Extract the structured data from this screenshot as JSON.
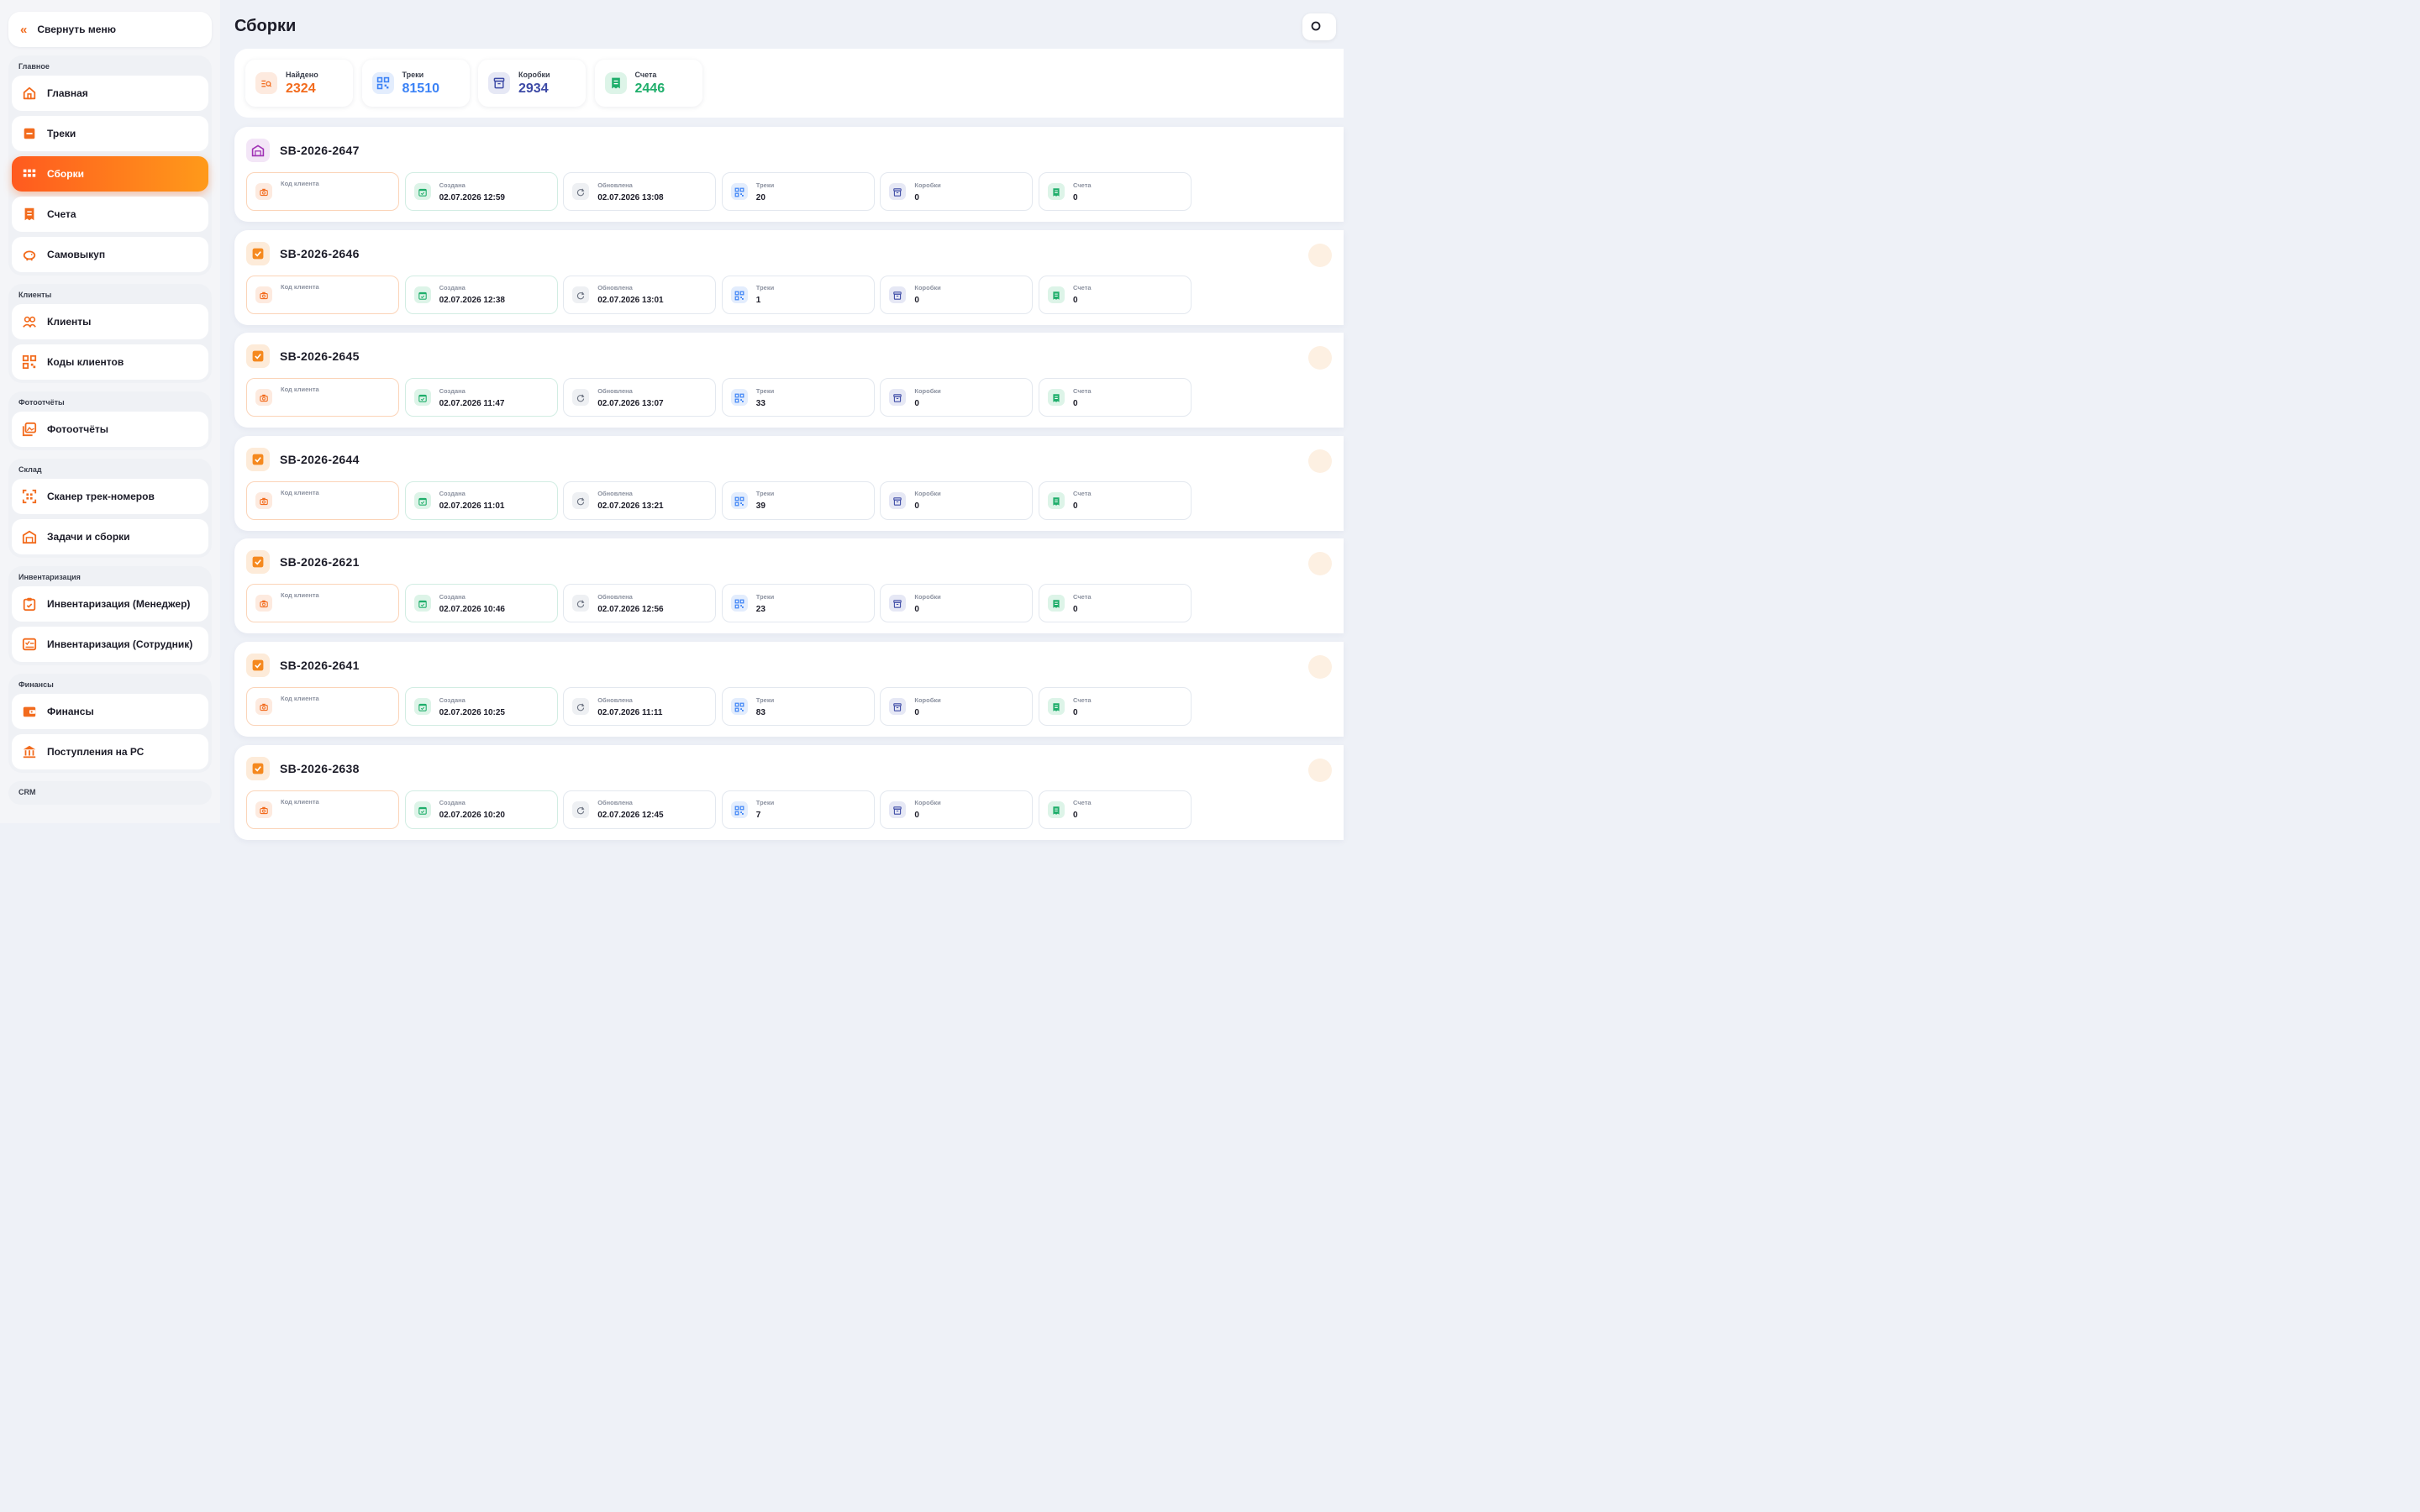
{
  "sidebar": {
    "collapse_label": "Свернуть меню",
    "groups": [
      {
        "title": "Главное",
        "items": [
          {
            "label": "Главная",
            "icon": "home-icon"
          },
          {
            "label": "Треки",
            "icon": "box-icon"
          },
          {
            "label": "Сборки",
            "icon": "grid-icon",
            "active": true
          },
          {
            "label": "Счета",
            "icon": "receipt-icon"
          },
          {
            "label": "Самовыкуп",
            "icon": "piggy-bank-icon"
          }
        ]
      },
      {
        "title": "Клиенты",
        "items": [
          {
            "label": "Клиенты",
            "icon": "users-icon"
          },
          {
            "label": "Коды клиентов",
            "icon": "qr-code-icon"
          }
        ]
      },
      {
        "title": "Фотоотчёты",
        "items": [
          {
            "label": "Фотоотчёты",
            "icon": "photos-icon"
          }
        ]
      },
      {
        "title": "Склад",
        "items": [
          {
            "label": "Сканер трек-номеров",
            "icon": "scanner-icon"
          },
          {
            "label": "Задачи и сборки",
            "icon": "warehouse-icon"
          }
        ]
      },
      {
        "title": "Инвентаризация",
        "items": [
          {
            "label": "Инвентаризация (Менеджер)",
            "icon": "clipboard-icon"
          },
          {
            "label": "Инвентаризация (Сотрудник)",
            "icon": "checklist-icon"
          }
        ]
      },
      {
        "title": "Финансы",
        "items": [
          {
            "label": "Финансы",
            "icon": "wallet-icon"
          },
          {
            "label": "Поступления на РС",
            "icon": "bank-icon"
          }
        ]
      },
      {
        "title": "CRM",
        "items": []
      }
    ]
  },
  "header": {
    "title": "Сборки"
  },
  "stats": [
    {
      "label": "Найдено",
      "value": "2324",
      "color": "#f26b1d",
      "bg": "#fdeadf",
      "icon": "search-list-icon"
    },
    {
      "label": "Треки",
      "value": "81510",
      "color": "#3b82f6",
      "bg": "#e3edfd",
      "icon": "qr-code-icon"
    },
    {
      "label": "Коробки",
      "value": "2934",
      "color": "#3d4aa6",
      "bg": "#e6e8f5",
      "icon": "archive-icon"
    },
    {
      "label": "Счета",
      "value": "2446",
      "color": "#1fae6b",
      "bg": "#ddf4e8",
      "icon": "receipt-icon"
    }
  ],
  "field_labels": {
    "client": "Код клиента",
    "created": "Создана",
    "updated": "Обновлена",
    "tracks": "Треки",
    "boxes": "Коробки",
    "invoices": "Счета"
  },
  "colors": {
    "accent": "#f26b1d",
    "created": "#1fae6b",
    "updated": "#6b7280",
    "tracks": "#3b82f6",
    "boxes": "#3d4aa6",
    "invoices": "#1fae6b"
  },
  "assemblies": [
    {
      "id": "SB-2026-2647",
      "status": "warehouse",
      "client": "",
      "created": "02.07.2026 12:59",
      "updated": "02.07.2026 13:08",
      "tracks": "20",
      "boxes": "0",
      "invoices": "0"
    },
    {
      "id": "SB-2026-2646",
      "status": "done",
      "client": "",
      "created": "02.07.2026 12:38",
      "updated": "02.07.2026 13:01",
      "tracks": "1",
      "boxes": "0",
      "invoices": "0"
    },
    {
      "id": "SB-2026-2645",
      "status": "done",
      "client": "",
      "created": "02.07.2026 11:47",
      "updated": "02.07.2026 13:07",
      "tracks": "33",
      "boxes": "0",
      "invoices": "0"
    },
    {
      "id": "SB-2026-2644",
      "status": "done",
      "client": "",
      "created": "02.07.2026 11:01",
      "updated": "02.07.2026 13:21",
      "tracks": "39",
      "boxes": "0",
      "invoices": "0"
    },
    {
      "id": "SB-2026-2621",
      "status": "done",
      "client": "",
      "created": "02.07.2026 10:46",
      "updated": "02.07.2026 12:56",
      "tracks": "23",
      "boxes": "0",
      "invoices": "0"
    },
    {
      "id": "SB-2026-2641",
      "status": "done",
      "client": "",
      "created": "02.07.2026 10:25",
      "updated": "02.07.2026 11:11",
      "tracks": "83",
      "boxes": "0",
      "invoices": "0"
    },
    {
      "id": "SB-2026-2638",
      "status": "done",
      "client": "",
      "created": "02.07.2026 10:20",
      "updated": "02.07.2026 12:45",
      "tracks": "7",
      "boxes": "0",
      "invoices": "0"
    }
  ]
}
